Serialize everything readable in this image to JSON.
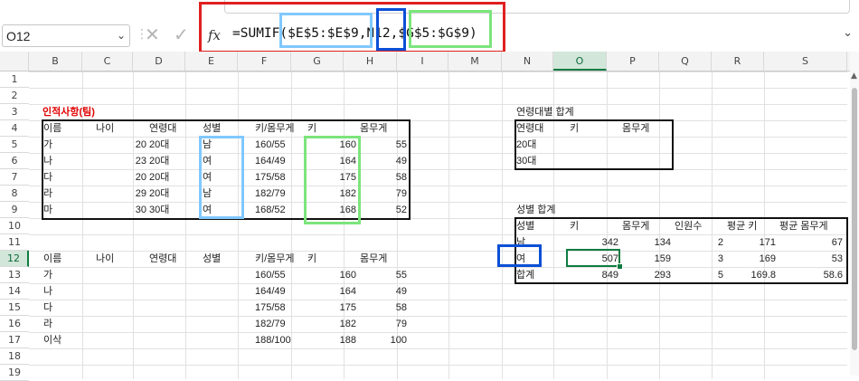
{
  "name_box": "O12",
  "formula_parts": {
    "prefix": "=SUMIF(",
    "range1": "$E$5:$E$9",
    "comma1": ",",
    "criteria": "N12",
    "comma2": ",",
    "range2": "$G$5:$G$9",
    "suffix": ")"
  },
  "icons": {
    "namebox_dropdown": "chevron-down-icon",
    "cancel": "x-icon",
    "enter": "check-icon",
    "function": "fx-icon",
    "expand": "chevron-down-icon"
  },
  "fx_label": "fx",
  "columns": [
    "B",
    "C",
    "D",
    "E",
    "F",
    "G",
    "H",
    "I",
    "M",
    "N",
    "O",
    "P",
    "Q",
    "R",
    "S"
  ],
  "rows": [
    "1",
    "2",
    "3",
    "4",
    "5",
    "6",
    "7",
    "8",
    "9",
    "10",
    "11",
    "12",
    "13",
    "14",
    "15",
    "16",
    "17",
    "18",
    "19"
  ],
  "colors": {
    "highlight_red": "#e02020",
    "highlight_lightblue": "#80c8ff",
    "highlight_blue": "#0b4fd6",
    "highlight_green": "#7ce57c",
    "selection_green": "#107c41",
    "title_red": "#e00000"
  },
  "table1": {
    "title": "인적사항(팀)",
    "headers": [
      "이름",
      "나이",
      "연령대",
      "성별",
      "키/몸무게",
      "키",
      "몸무게"
    ],
    "rows": [
      [
        "가",
        "20",
        "20대",
        "남",
        "160/55",
        "160",
        "55"
      ],
      [
        "나",
        "23",
        "20대",
        "여",
        "164/49",
        "164",
        "49"
      ],
      [
        "다",
        "20",
        "20대",
        "여",
        "175/58",
        "175",
        "58"
      ],
      [
        "라",
        "29",
        "20대",
        "남",
        "182/79",
        "182",
        "79"
      ],
      [
        "마",
        "30",
        "30대",
        "여",
        "168/52",
        "168",
        "52"
      ]
    ]
  },
  "table2": {
    "headers": [
      "이름",
      "나이",
      "연령대",
      "성별",
      "키/몸무게",
      "키",
      "몸무게"
    ],
    "rows": [
      [
        "가",
        "",
        "",
        "",
        "160/55",
        "160",
        "55"
      ],
      [
        "나",
        "",
        "",
        "",
        "164/49",
        "164",
        "49"
      ],
      [
        "다",
        "",
        "",
        "",
        "175/58",
        "175",
        "58"
      ],
      [
        "라",
        "",
        "",
        "",
        "182/79",
        "182",
        "79"
      ],
      [
        "이삭",
        "",
        "",
        "",
        "188/100",
        "188",
        "100"
      ]
    ]
  },
  "age_table": {
    "title": "연령대별 합계",
    "headers": [
      "연령대",
      "키",
      "몸무게"
    ],
    "rows": [
      [
        "20대",
        "",
        ""
      ],
      [
        "30대",
        "",
        ""
      ]
    ]
  },
  "gender_table": {
    "title": "성별 합계",
    "headers": [
      "성별",
      "키",
      "몸무게",
      "인원수",
      "평균 키",
      "평균 몸무게"
    ],
    "rows": [
      [
        "남",
        "342",
        "134",
        "2",
        "171",
        "67"
      ],
      [
        "여",
        "507",
        "159",
        "3",
        "169",
        "53"
      ],
      [
        "합계",
        "849",
        "293",
        "5",
        "169.8",
        "58.6"
      ]
    ]
  }
}
